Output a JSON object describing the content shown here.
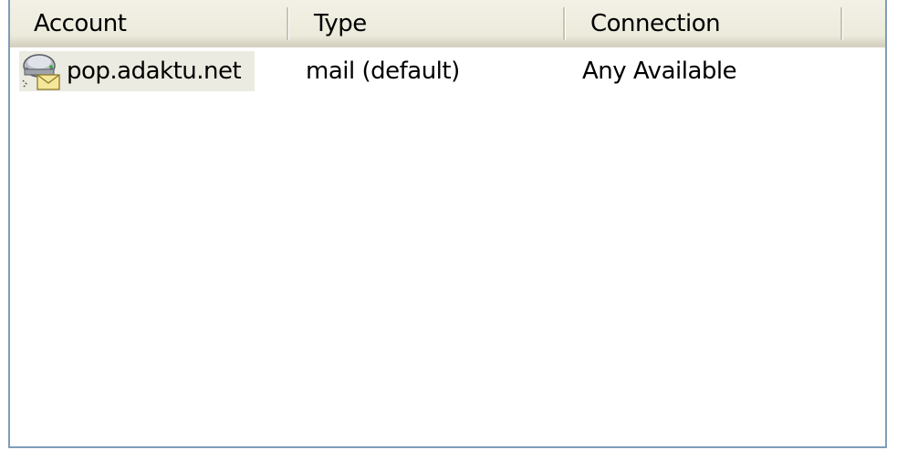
{
  "columns": {
    "account": "Account",
    "type": "Type",
    "connection": "Connection"
  },
  "rows": [
    {
      "account": "pop.adaktu.net",
      "type": "mail (default)",
      "connection": "Any Available",
      "icon": "mail-server-icon",
      "selected": true
    }
  ]
}
